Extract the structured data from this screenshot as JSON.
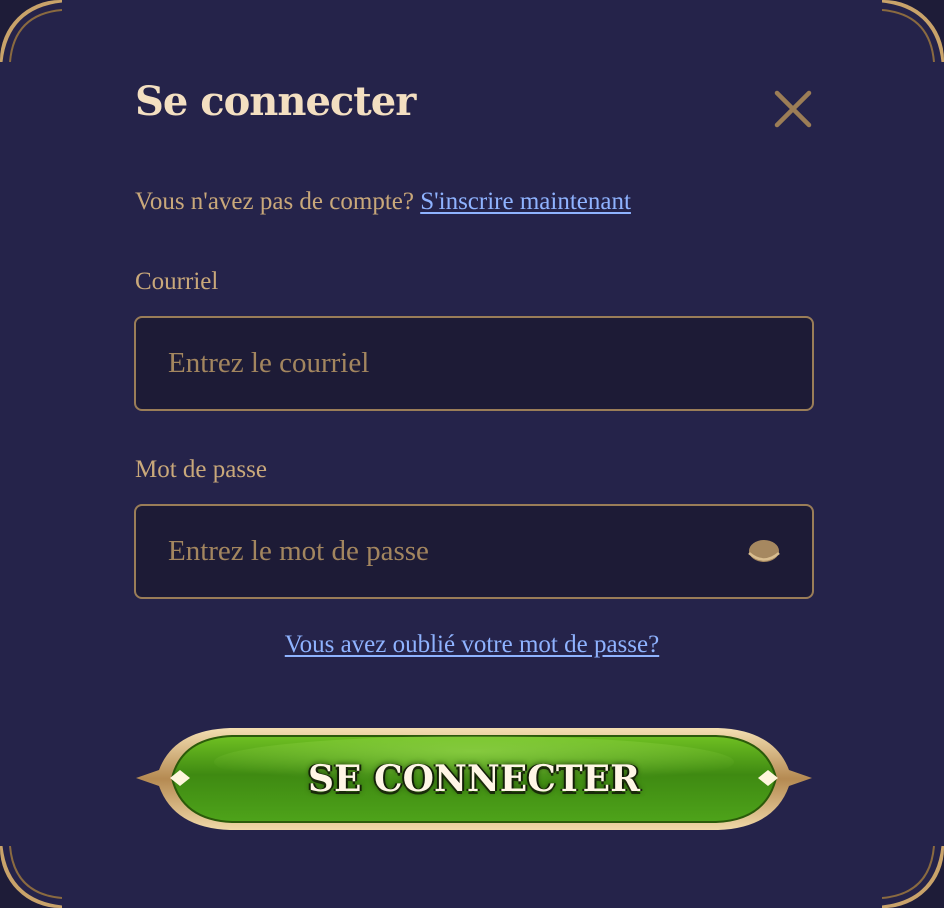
{
  "modal": {
    "title": "Se connecter",
    "close_icon": "close-icon"
  },
  "signup_prompt": {
    "text": "Vous n'avez pas de compte? ",
    "link_label": "S'inscrire maintenant"
  },
  "email": {
    "label": "Courriel",
    "placeholder": "Entrez le courriel",
    "value": ""
  },
  "password": {
    "label": "Mot de passe",
    "placeholder": "Entrez le mot de passe",
    "value": "",
    "toggle_icon": "eye-icon"
  },
  "forgot_link": "Vous avez oublié votre mot de passe?",
  "submit_button": {
    "label": "SE CONNECTER"
  },
  "colors": {
    "background": "#25234a",
    "title": "#f3dfc1",
    "text": "#c9a87a",
    "link": "#8fb3ff",
    "input_border": "#9a7d58",
    "button_green": "#4e9a1c",
    "button_frame": "#e2c48d"
  }
}
